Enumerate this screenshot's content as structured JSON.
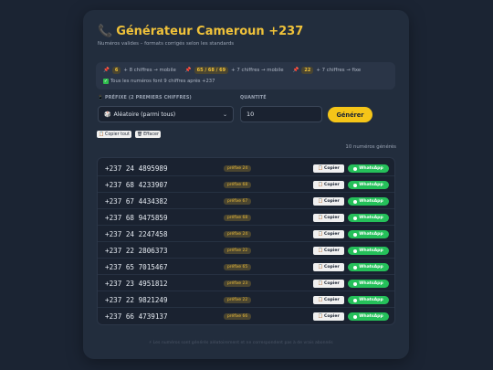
{
  "header": {
    "title_icon": "phone-icon",
    "title": "Générateur Cameroun +237",
    "subtitle": "Numéros valides – formats corrigés selon les standards"
  },
  "info": {
    "groups": [
      {
        "badge": "6",
        "text": "+ 8 chiffres → mobile"
      },
      {
        "badge": "65 / 68 / 69",
        "text": "+ 7 chiffres → mobile"
      },
      {
        "badge": "22",
        "text": "+ 7 chiffres → fixe"
      }
    ],
    "note": "Tous les numéros font 9 chiffres après +237"
  },
  "form": {
    "prefix_label": "📱 PRÉFIXE (2 PREMIERS CHIFFRES)",
    "prefix_value": "Aléatoire (parmi tous)",
    "quantity_label": "QUANTITÉ",
    "quantity_value": "10",
    "generate_label": "Générer"
  },
  "actions": {
    "copy_all": "Copier tout",
    "clear": "Effacer"
  },
  "count_text": "10 numéros générés",
  "rows": [
    {
      "number": "+237 24 4895989",
      "prefix": "préfixe 24"
    },
    {
      "number": "+237 68 4233907",
      "prefix": "préfixe 68"
    },
    {
      "number": "+237 67 4434382",
      "prefix": "préfixe 67"
    },
    {
      "number": "+237 68 9475859",
      "prefix": "préfixe 68"
    },
    {
      "number": "+237 24 2247458",
      "prefix": "préfixe 24"
    },
    {
      "number": "+237 22 2806373",
      "prefix": "préfixe 22"
    },
    {
      "number": "+237 65 7015467",
      "prefix": "préfixe 65"
    },
    {
      "number": "+237 23 4951812",
      "prefix": "préfixe 23"
    },
    {
      "number": "+237 22 9821249",
      "prefix": "préfixe 22"
    },
    {
      "number": "+237 66 4739137",
      "prefix": "préfixe 66"
    }
  ],
  "row_buttons": {
    "copy": "Copier",
    "whatsapp": "WhatsApp"
  },
  "footer": "⚡ Les numéros sont générés aléatoirement et ne correspondent pas à de vrais abonnés",
  "colors": {
    "accent": "#f5c518",
    "whatsapp": "#25c05a",
    "background": "#1b2433",
    "card": "#222d3d"
  }
}
